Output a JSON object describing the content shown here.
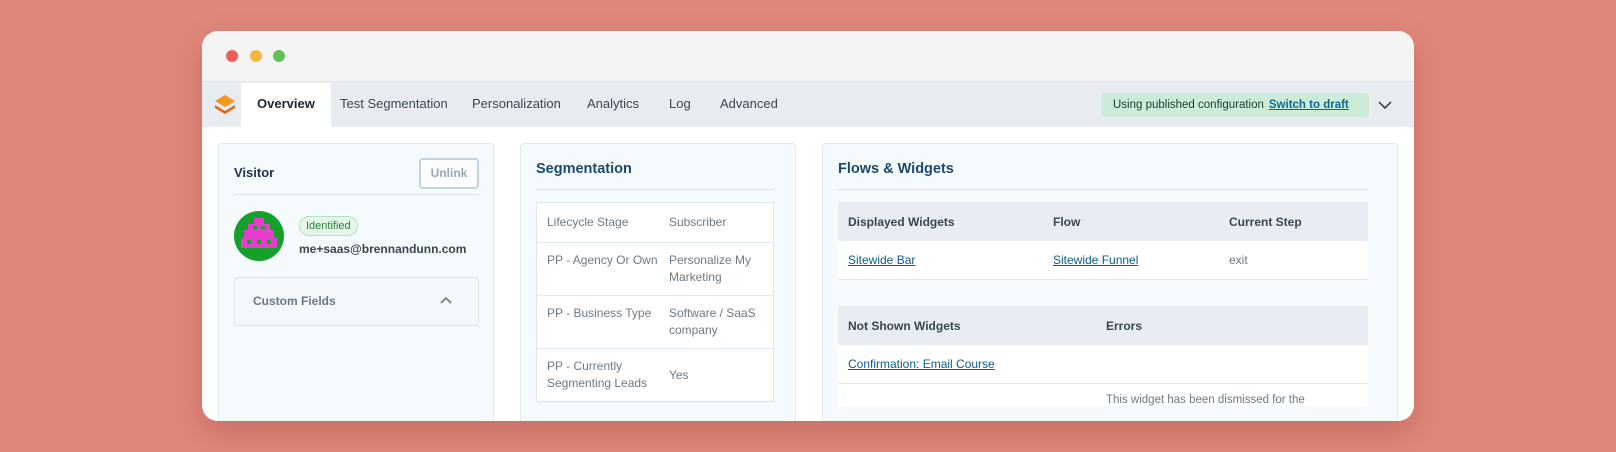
{
  "nav": {
    "tabs": [
      {
        "label": "Overview"
      },
      {
        "label": "Test Segmentation"
      },
      {
        "label": "Personalization"
      },
      {
        "label": "Analytics"
      },
      {
        "label": "Log"
      },
      {
        "label": "Advanced"
      }
    ],
    "config_status": "Using published configuration",
    "config_link": "Switch to draft"
  },
  "visitor": {
    "title": "Visitor",
    "unlink_label": "Unlink",
    "badge": "Identified",
    "email": "me+saas@brennandunn.com",
    "custom_fields_label": "Custom Fields"
  },
  "segmentation": {
    "title": "Segmentation",
    "rows": [
      {
        "key": "Lifecycle Stage",
        "value": "Subscriber"
      },
      {
        "key": "PP - Agency Or Own",
        "value": "Personalize My Marketing"
      },
      {
        "key": "PP - Business Type",
        "value": "Software / SaaS company"
      },
      {
        "key": "PP - Currently Segmenting Leads",
        "value": "Yes"
      }
    ]
  },
  "flows": {
    "title": "Flows & Widgets",
    "displayed": {
      "headers": [
        "Displayed Widgets",
        "Flow",
        "Current Step"
      ],
      "rows": [
        {
          "widget": "Sitewide Bar",
          "flow": "Sitewide Funnel",
          "step": "exit"
        }
      ]
    },
    "not_shown": {
      "headers": [
        "Not Shown Widgets",
        "Errors"
      ],
      "rows": [
        {
          "widget": "Confirmation: Email Course",
          "error": ""
        },
        {
          "widget": "",
          "error": "This widget has been dismissed for the"
        }
      ]
    }
  },
  "colors": {
    "accent": "#0c5d85",
    "logo_orange": "#f07a12",
    "avatar_bg": "#13a12b",
    "avatar_fg": "#e83ccd",
    "banner_bg": "#ccecd7"
  }
}
